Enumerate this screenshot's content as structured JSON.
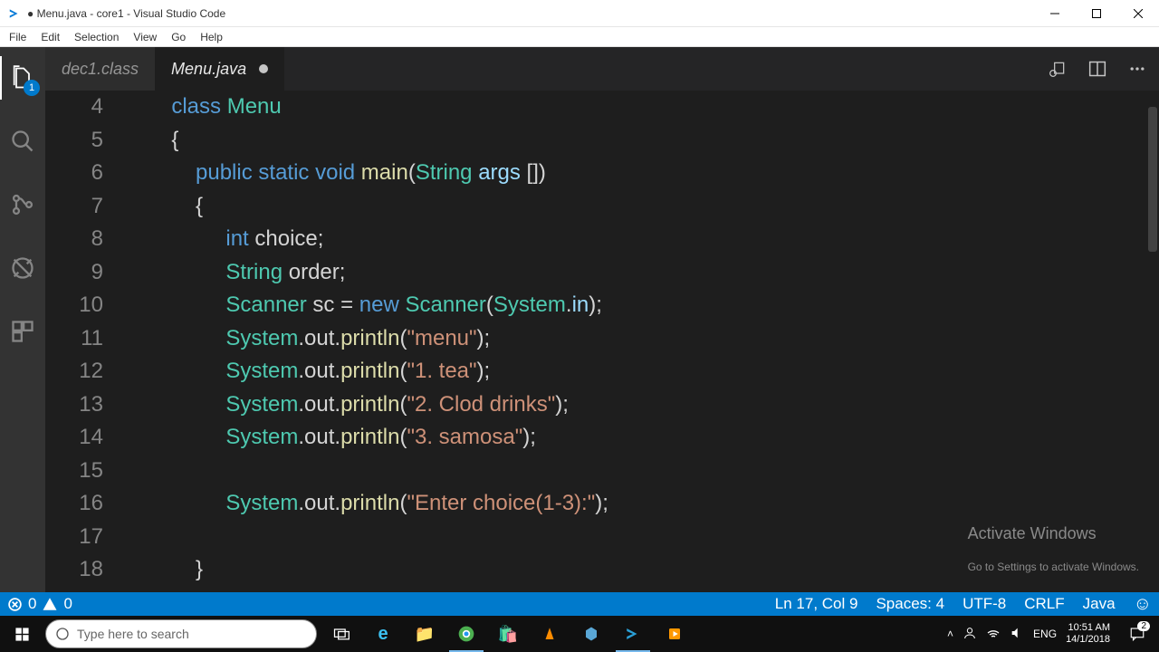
{
  "titlebar": {
    "title": "● Menu.java - core1 - Visual Studio Code"
  },
  "menu": {
    "items": [
      "File",
      "Edit",
      "Selection",
      "View",
      "Go",
      "Help"
    ]
  },
  "activity": {
    "badge": "1"
  },
  "tabs": {
    "inactive": "dec1.class",
    "active": "Menu.java"
  },
  "gutter": [
    "4",
    "5",
    "6",
    "7",
    "8",
    "9",
    "10",
    "11",
    "12",
    "13",
    "14",
    "15",
    "16",
    "17",
    "18"
  ],
  "code": {
    "l4": {
      "kw": "class",
      "name": "Menu"
    },
    "l6": {
      "kw1": "public",
      "kw2": "static",
      "kw3": "void",
      "fn": "main",
      "type": "String",
      "arg": "args"
    },
    "l8": {
      "type": "int",
      "var": "choice"
    },
    "l9": {
      "type": "String",
      "var": "order"
    },
    "l10": {
      "type": "Scanner",
      "var": "sc",
      "kw": "new",
      "ctor": "Scanner",
      "obj": "System",
      "fld": "in"
    },
    "l11": {
      "obj": "System",
      "o2": "out",
      "m": "println",
      "str": "\"menu\""
    },
    "l12": {
      "obj": "System",
      "o2": "out",
      "m": "println",
      "str": "\"1. tea\""
    },
    "l13": {
      "obj": "System",
      "o2": "out",
      "m": "println",
      "str": "\"2. Clod drinks\""
    },
    "l14": {
      "obj": "System",
      "o2": "out",
      "m": "println",
      "str": "\"3. samosa\""
    },
    "l16": {
      "obj": "System",
      "o2": "out",
      "m": "println",
      "str": "\"Enter choice(1-3):\""
    }
  },
  "activate": {
    "l1": "Activate Windows",
    "l2": "Go to Settings to activate Windows."
  },
  "status": {
    "errors": "0",
    "warnings": "0",
    "pos": "Ln 17, Col 9",
    "spaces": "Spaces: 4",
    "enc": "UTF-8",
    "eol": "CRLF",
    "lang": "Java"
  },
  "taskbar": {
    "search_placeholder": "Type here to search",
    "lang": "ENG",
    "time": "10:51 AM",
    "date": "14/1/2018",
    "notif": "2"
  }
}
